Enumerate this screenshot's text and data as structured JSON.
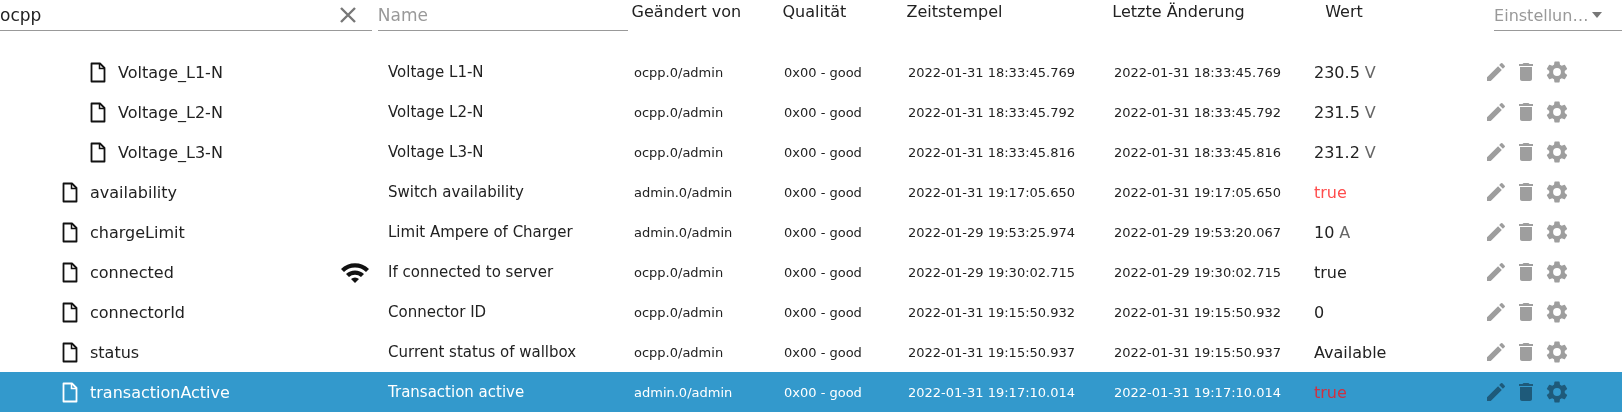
{
  "filter": {
    "search": {
      "value": "ocpp"
    },
    "name": {
      "placeholder": "Name"
    },
    "settings": {
      "placeholder": "Einstellun…"
    }
  },
  "columns": [
    "Geändert von",
    "Qualität",
    "Zeitstempel",
    "Letzte Änderung",
    "Wert"
  ],
  "rows": [
    {
      "children": [
        {
          "id": "Voltage_L1-N",
          "name": "Voltage L1-N",
          "has_icon": false,
          "changed_by": "ocpp.0/admin",
          "quality": "0x00 - good",
          "timestamp": "2022-01-31 18:33:45.769",
          "last_change": "2022-01-31 18:33:45.769",
          "value": "230.5",
          "unit": "V",
          "color": "#222222",
          "selected": false
        },
        {
          "id": "Voltage_L2-N",
          "name": "Voltage L2-N",
          "has_icon": false,
          "changed_by": "ocpp.0/admin",
          "quality": "0x00 - good",
          "timestamp": "2022-01-31 18:33:45.792",
          "last_change": "2022-01-31 18:33:45.792",
          "value": "231.5",
          "unit": "V",
          "color": "#222222",
          "selected": false
        },
        {
          "id": "Voltage_L3-N",
          "name": "Voltage L3-N",
          "has_icon": false,
          "changed_by": "ocpp.0/admin",
          "quality": "0x00 - good",
          "timestamp": "2022-01-31 18:33:45.816",
          "last_change": "2022-01-31 18:33:45.816",
          "value": "231.2",
          "unit": "V",
          "color": "#222222",
          "selected": false
        }
      ]
    },
    {
      "id": "availability",
      "name": "Switch availability",
      "has_icon": false,
      "changed_by": "admin.0/admin",
      "quality": "0x00 - good",
      "timestamp": "2022-01-31 19:17:05.650",
      "last_change": "2022-01-31 19:17:05.650",
      "value": "true",
      "color": "#ff4d4d",
      "selected": false
    },
    {
      "id": "chargeLimit",
      "name": "Limit Ampere of Charger",
      "has_icon": false,
      "changed_by": "admin.0/admin",
      "quality": "0x00 - good",
      "timestamp": "2022-01-29 19:53:25.974",
      "last_change": "2022-01-29 19:53:20.067",
      "value": "10",
      "unit": "A",
      "color": "#222222",
      "selected": false
    },
    {
      "id": "connected",
      "name": "If connected to server",
      "has_icon": true,
      "changed_by": "ocpp.0/admin",
      "quality": "0x00 - good",
      "timestamp": "2022-01-29 19:30:02.715",
      "last_change": "2022-01-29 19:30:02.715",
      "value": "true",
      "color": "#222222",
      "selected": false
    },
    {
      "id": "connectorId",
      "name": "Connector ID",
      "has_icon": false,
      "changed_by": "ocpp.0/admin",
      "quality": "0x00 - good",
      "timestamp": "2022-01-31 19:15:50.932",
      "last_change": "2022-01-31 19:15:50.932",
      "value": "0",
      "color": "#222222",
      "selected": false
    },
    {
      "id": "status",
      "name": "Current status of wallbox",
      "has_icon": false,
      "changed_by": "ocpp.0/admin",
      "quality": "0x00 - good",
      "timestamp": "2022-01-31 19:15:50.937",
      "last_change": "2022-01-31 19:15:50.937",
      "value": "Available",
      "color": "#222222",
      "selected": false
    },
    {
      "id": "transactionActive",
      "name": "Transaction active",
      "has_icon": false,
      "changed_by": "admin.0/admin",
      "quality": "0x00 - good",
      "timestamp": "2022-01-31 19:17:10.014",
      "last_change": "2022-01-31 19:17:10.014",
      "value": "true",
      "color": "#d03040",
      "selected": true
    }
  ]
}
